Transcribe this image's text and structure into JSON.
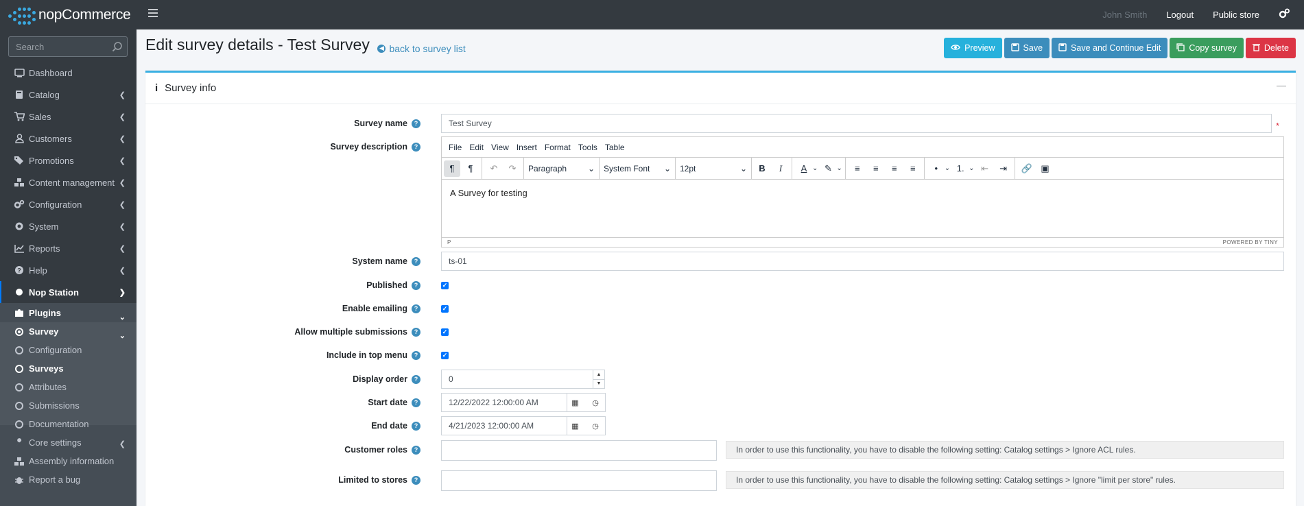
{
  "brand": {
    "name": "nopCommerce"
  },
  "topbar": {
    "user": "John Smith",
    "logout": "Logout",
    "public_store": "Public store"
  },
  "sidebar": {
    "search_placeholder": "Search",
    "items": [
      {
        "label": "Dashboard",
        "icon": "monitor-icon"
      },
      {
        "label": "Catalog",
        "icon": "book-icon"
      },
      {
        "label": "Sales",
        "icon": "cart-icon"
      },
      {
        "label": "Customers",
        "icon": "user-icon"
      },
      {
        "label": "Promotions",
        "icon": "tags-icon"
      },
      {
        "label": "Content management",
        "icon": "cubes-icon"
      },
      {
        "label": "Configuration",
        "icon": "gears-icon"
      },
      {
        "label": "System",
        "icon": "cog-icon"
      },
      {
        "label": "Reports",
        "icon": "chart-icon"
      },
      {
        "label": "Help",
        "icon": "question-icon"
      },
      {
        "label": "Nop Station",
        "icon": "circle-icon"
      },
      {
        "label": "Plugins",
        "icon": "puzzle-icon"
      },
      {
        "label": "Survey",
        "icon": "dot-circle-icon"
      },
      {
        "label": "Configuration",
        "icon": "circle-outline-icon"
      },
      {
        "label": "Surveys",
        "icon": "circle-outline-icon"
      },
      {
        "label": "Attributes",
        "icon": "circle-outline-icon"
      },
      {
        "label": "Submissions",
        "icon": "circle-outline-icon"
      },
      {
        "label": "Documentation",
        "icon": "circle-outline-icon"
      },
      {
        "label": "Core settings",
        "icon": "wrench-icon"
      },
      {
        "label": "Assembly information",
        "icon": "cubes-icon"
      },
      {
        "label": "Report a bug",
        "icon": "bug-icon"
      }
    ]
  },
  "header": {
    "title": "Edit survey details - Test Survey",
    "back_link": "back to survey list"
  },
  "actions": {
    "preview": "Preview",
    "save": "Save",
    "save_continue": "Save and Continue Edit",
    "copy": "Copy survey",
    "delete": "Delete"
  },
  "card": {
    "title": "Survey info"
  },
  "form": {
    "survey_name_label": "Survey name",
    "survey_name_value": "Test Survey",
    "survey_description_label": "Survey description",
    "editor_menu": [
      "File",
      "Edit",
      "View",
      "Insert",
      "Format",
      "Tools",
      "Table"
    ],
    "editor_block_format": "Paragraph",
    "editor_font": "System Font",
    "editor_size": "12pt",
    "editor_content": "A Survey for testing",
    "editor_status_path": "P",
    "editor_powered": "POWERED BY TINY",
    "system_name_label": "System name",
    "system_name_value": "ts-01",
    "published_label": "Published",
    "enable_emailing_label": "Enable emailing",
    "allow_multiple_label": "Allow multiple submissions",
    "include_top_menu_label": "Include in top menu",
    "display_order_label": "Display order",
    "display_order_value": "0",
    "start_date_label": "Start date",
    "start_date_value": "12/22/2022 12:00:00 AM",
    "end_date_label": "End date",
    "end_date_value": "4/21/2023 12:00:00 AM",
    "customer_roles_label": "Customer roles",
    "customer_roles_notice": "In order to use this functionality, you have to disable the following setting: Catalog settings > Ignore ACL rules.",
    "limited_stores_label": "Limited to stores",
    "limited_stores_notice": "In order to use this functionality, you have to disable the following setting: Catalog settings > Ignore \"limit per store\" rules."
  }
}
